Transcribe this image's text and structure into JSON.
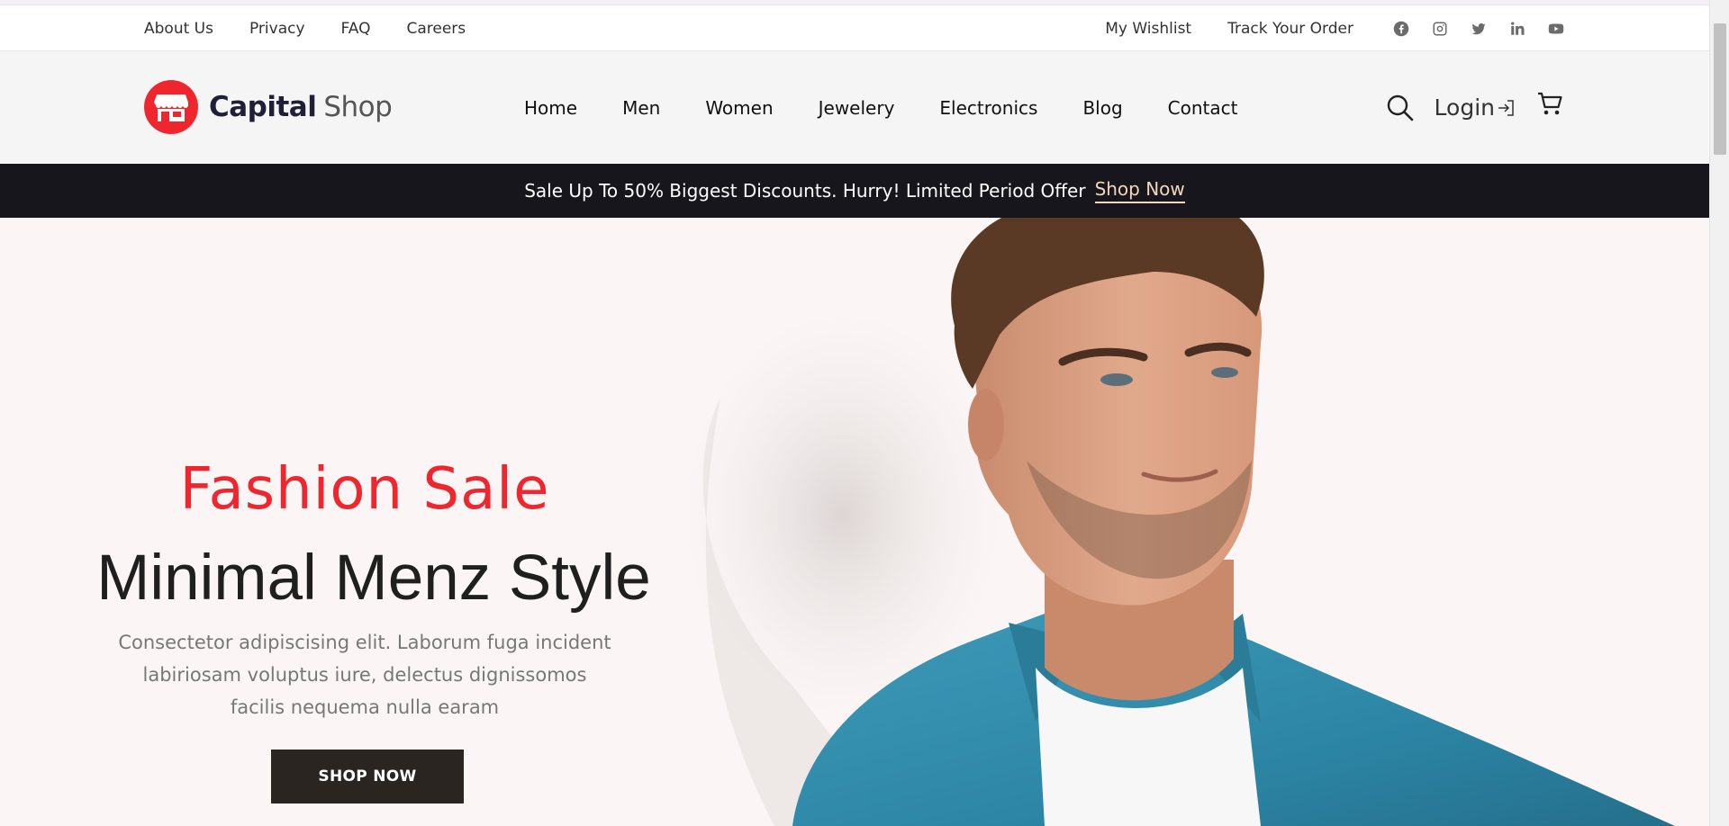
{
  "topbar": {
    "left_links": [
      {
        "label": "About Us"
      },
      {
        "label": "Privacy"
      },
      {
        "label": "FAQ"
      },
      {
        "label": "Careers"
      }
    ],
    "right_links": [
      {
        "label": "My Wishlist"
      },
      {
        "label": "Track Your Order"
      }
    ],
    "socials": [
      "facebook-icon",
      "instagram-icon",
      "twitter-icon",
      "linkedin-icon",
      "youtube-icon"
    ]
  },
  "header": {
    "logo_bold": "Capital",
    "logo_light": "Shop",
    "nav": [
      {
        "label": "Home"
      },
      {
        "label": "Men"
      },
      {
        "label": "Women"
      },
      {
        "label": "Jewelery"
      },
      {
        "label": "Electronics"
      },
      {
        "label": "Blog"
      },
      {
        "label": "Contact"
      }
    ],
    "login_label": "Login"
  },
  "promo": {
    "text": "Sale Up To 50% Biggest Discounts. Hurry! Limited Period Offer",
    "link_label": "Shop Now"
  },
  "hero": {
    "subtitle": "Fashion Sale",
    "title": "Minimal Menz Style",
    "description": "Consectetor adipiscising elit. Laborum fuga incident labiriosam voluptus iure, delectus dignissomos facilis nequema nulla earam",
    "button_label": "SHOP NOW"
  },
  "colors": {
    "brand_red": "#f0262e",
    "promo_bg": "#16161c",
    "promo_link": "#f2d7bc",
    "button_bg": "#2a2520",
    "header_bg": "#f5f5f5",
    "hero_bg": "#fbf6f5"
  }
}
